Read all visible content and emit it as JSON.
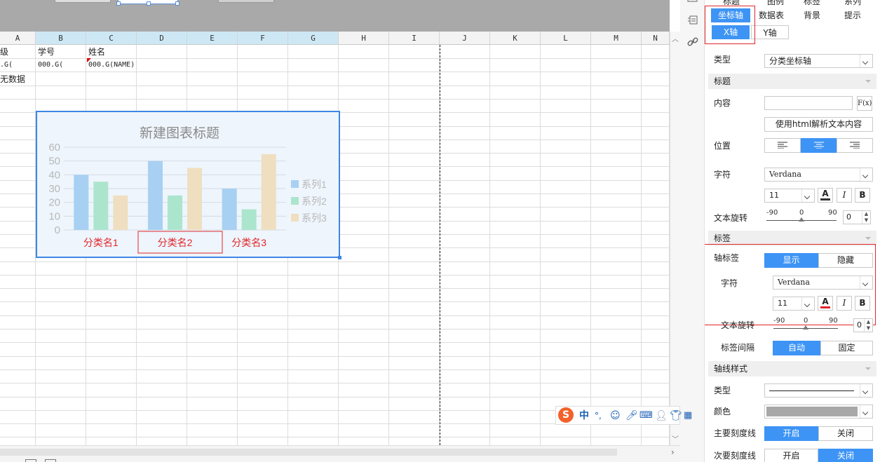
{
  "sheet": {
    "columns": [
      "A",
      "B",
      "C",
      "D",
      "E",
      "F",
      "G",
      "H",
      "I",
      "J",
      "K",
      "L",
      "M",
      "N"
    ],
    "cells": {
      "a1": "级",
      "b1": "学号",
      "c1": "姓名",
      "a2": ".G(",
      "b2": "000.G(",
      "c2": "000.G(NAME)",
      "a3": "无数据"
    }
  },
  "chart_data": {
    "type": "bar",
    "title": "新建图表标题",
    "categories": [
      "分类名1",
      "分类名2",
      "分类名3"
    ],
    "series": [
      {
        "name": "系列1",
        "values": [
          40,
          50,
          30
        ],
        "color": "#a8d0f2"
      },
      {
        "name": "系列2",
        "values": [
          35,
          25,
          15
        ],
        "color": "#ace5cd"
      },
      {
        "name": "系列3",
        "values": [
          25,
          45,
          55
        ],
        "color": "#efdfc0"
      }
    ],
    "ylim": [
      0,
      60
    ],
    "yticks": [
      "0",
      "10",
      "20",
      "30",
      "40",
      "50",
      "60"
    ],
    "legend": "right",
    "grid": true,
    "category_label_color": "#e0262a"
  },
  "panel": {
    "top_tabs": [
      "标题",
      "图例",
      "标签",
      "系列"
    ],
    "tabs_row1": [
      "坐标轴",
      "数据表",
      "背景",
      "提示"
    ],
    "axis_tabs": [
      "X轴",
      "Y轴"
    ],
    "type_label": "类型",
    "type_value": "分类坐标轴",
    "title_section": "标题",
    "content_label": "内容",
    "content_value": "",
    "fx_button": "F(x)",
    "html_button": "使用html解析文本内容",
    "position_label": "位置",
    "font_label": "字符",
    "font_value": "Verdana",
    "font_size": "11",
    "italic": "I",
    "bold": "B",
    "rotate_label": "文本旋转",
    "rotate_ticks": [
      "-90",
      "0",
      "90"
    ],
    "rotate_value": "0",
    "label_section": "标签",
    "axis_label_label": "轴标签",
    "show": "显示",
    "hide": "隐藏",
    "label_font_label": "字符",
    "label_font_value": "Verdana",
    "label_font_size": "11",
    "label_rotate_label": "文本旋转",
    "label_rotate_value": "0",
    "interval_label": "标签间隔",
    "auto": "自动",
    "fixed": "固定",
    "axisline_section": "轴线样式",
    "line_type_label": "类型",
    "color_label": "颜色",
    "major_tick_label": "主要刻度线",
    "minor_tick_label": "次要刻度线",
    "on": "开启",
    "off": "关闭",
    "accent": "#3d94f5",
    "highlight_border": "#e0262a"
  },
  "ime": {
    "logo": "S",
    "lang": "中",
    "punct": "°,"
  }
}
